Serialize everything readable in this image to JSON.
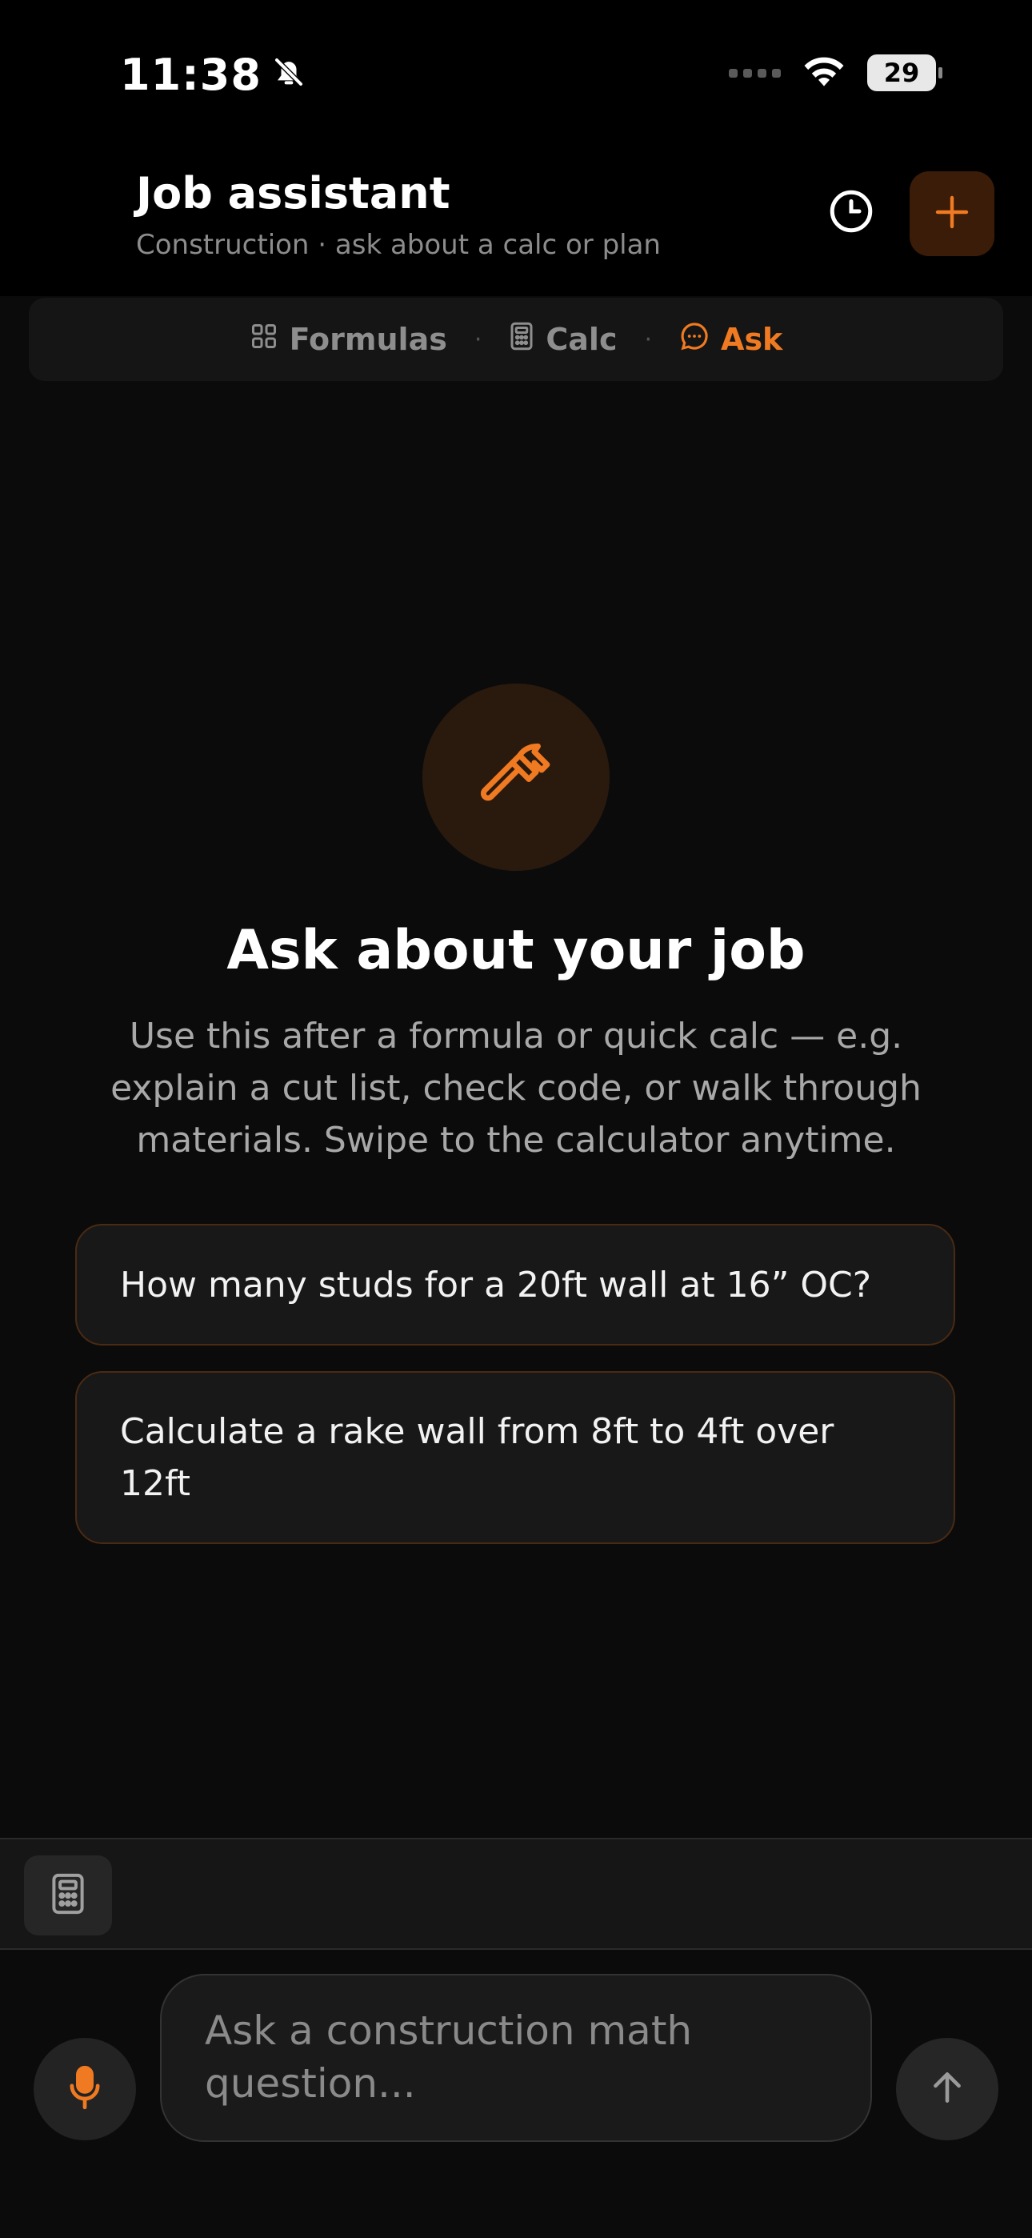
{
  "status": {
    "time": "11:38",
    "battery": "29"
  },
  "header": {
    "title": "Job assistant",
    "subtitle": "Construction · ask about a calc or plan"
  },
  "tabs": [
    {
      "label": "Formulas",
      "icon": "grid-icon",
      "active": false
    },
    {
      "label": "Calc",
      "icon": "calculator-icon",
      "active": false
    },
    {
      "label": "Ask",
      "icon": "chat-bubble-icon",
      "active": true
    }
  ],
  "tab_separator": "·",
  "empty_state": {
    "icon": "hammer-icon",
    "title": "Ask about your job",
    "description": "Use this after a formula or quick calc — e.g. explain a cut list, check code, or walk through materials. Swipe to the calculator anytime."
  },
  "suggestions": [
    "How many studs for a 20ft wall at 16” OC?",
    "Calculate a rake wall from 8ft to 4ft over 12ft"
  ],
  "composer": {
    "placeholder": "Ask a construction math question...",
    "value": ""
  },
  "colors": {
    "accent": "#f07a22",
    "background": "#0b0b0b",
    "header_bg": "#000000",
    "card_bg": "#181818",
    "card_border": "#4a2a12"
  }
}
